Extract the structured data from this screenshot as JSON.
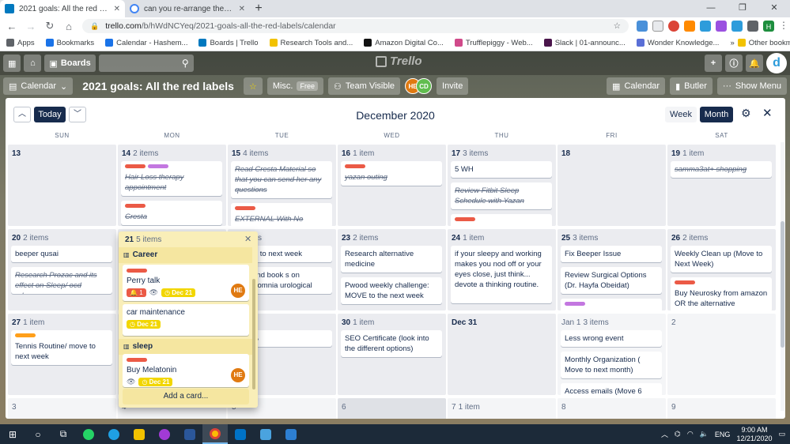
{
  "browser": {
    "tabs": [
      {
        "title": "2021 goals: All the red labels | Tr",
        "active": true
      },
      {
        "title": "can you re-arrange the cards in a",
        "active": false
      }
    ],
    "url_host": "trello.com",
    "url_path": "/b/hWdNCYeq/2021-goals-all-the-red-labels/calendar",
    "bookmarks": [
      {
        "label": "Apps",
        "color": "#5f6368"
      },
      {
        "label": "Bookmarks",
        "color": "#1a73e8"
      },
      {
        "label": "Calendar - Hashem...",
        "color": "#1a73e8"
      },
      {
        "label": "Boards | Trello",
        "color": "#0079bf"
      },
      {
        "label": "Research Tools and...",
        "color": "#f2c200"
      },
      {
        "label": "Amazon Digital Co...",
        "color": "#111111"
      },
      {
        "label": "Trufflepiggy - Web...",
        "color": "#d04a8a"
      },
      {
        "label": "Slack | 01-announc...",
        "color": "#4a154b"
      },
      {
        "label": "Wonder Knowledge...",
        "color": "#5a6fd6"
      }
    ],
    "other_bookmarks": "Other bookmarks",
    "profile_initial": "H"
  },
  "trello": {
    "boards_label": "Boards",
    "logo_text": "Trello",
    "board_view": "Calendar",
    "board_title": "2021 goals: All the red labels",
    "team_name": "Misc.",
    "team_plan": "Free",
    "visibility": "Team Visible",
    "members": [
      "HE",
      "CD"
    ],
    "invite": "Invite",
    "calendar_btn": "Calendar",
    "butler_btn": "Butler",
    "menu_btn": "Show Menu"
  },
  "calendar": {
    "today_label": "Today",
    "month_title": "December 2020",
    "week_label": "Week",
    "month_label": "Month",
    "days_of_week": [
      "SUN",
      "MON",
      "TUE",
      "WED",
      "THU",
      "FRI",
      "SAT"
    ],
    "weeks": [
      [
        {
          "day": "13",
          "count": "",
          "cards": []
        },
        {
          "day": "14",
          "count": "2 items",
          "cards": [
            {
              "labels": [
                "red",
                "purple"
              ],
              "text": "Hair Loss therapy appointment",
              "done": true
            },
            {
              "labels": [
                "red"
              ],
              "text": "Cresta",
              "done": true
            }
          ]
        },
        {
          "day": "15",
          "count": "4 items",
          "cards": [
            {
              "labels": [],
              "text": "Read Cresta Material so that you can send her any questions",
              "done": true
            },
            {
              "labels": [
                "red"
              ],
              "text": "EXTERNAL With No",
              "done": true
            }
          ]
        },
        {
          "day": "16",
          "count": "1 item",
          "cards": [
            {
              "labels": [
                "red"
              ],
              "text": "yazan outing",
              "done": true
            }
          ]
        },
        {
          "day": "17",
          "count": "3 items",
          "cards": [
            {
              "labels": [],
              "text": "5 WH",
              "done": false
            },
            {
              "labels": [],
              "text": "Review Fitbit Sleep Schedule with Yazan",
              "done": true
            },
            {
              "labels": [
                "red"
              ],
              "text": "",
              "done": false
            }
          ]
        },
        {
          "day": "18",
          "count": "",
          "cards": []
        },
        {
          "day": "19",
          "count": "1 item",
          "cards": [
            {
              "labels": [],
              "text": "samma3at+ shopping",
              "done": true
            }
          ]
        }
      ],
      [
        {
          "day": "20",
          "count": "2 items",
          "cards": [
            {
              "labels": [],
              "text": "beeper qusai",
              "done": false
            },
            {
              "labels": [],
              "text": "Research Prozac and its effect on Sleep/ ocd advance",
              "done": true
            }
          ]
        },
        {
          "day": "21",
          "count": "5 items",
          "cards": []
        },
        {
          "day": "22",
          "count": "items",
          "cards": [
            {
              "labels": [],
              "text": "ng: put to next week",
              "done": false
            },
            {
              "labels": [],
              "text": "t RG and book s on hypersomnia urological issues",
              "done": false
            }
          ]
        },
        {
          "day": "23",
          "count": "2 items",
          "cards": [
            {
              "labels": [],
              "text": "Research alternative medicine",
              "done": false
            },
            {
              "labels": [],
              "text": "Pwood weekly challenge: MOVE to the next week",
              "done": false
            }
          ]
        },
        {
          "day": "24",
          "count": "1 item",
          "cards": [
            {
              "labels": [],
              "text": "if your sleepy and working makes you nod off or your eyes close, just think... devote a thinking routine.",
              "done": false
            }
          ]
        },
        {
          "day": "25",
          "count": "3 items",
          "cards": [
            {
              "labels": [],
              "text": "Fix Beeper Issue",
              "done": false
            },
            {
              "labels": [],
              "text": "Review Surgical Options (Dr. Hayfa Obeidat)",
              "done": false
            },
            {
              "labels": [
                "purple"
              ],
              "text": "",
              "done": false
            }
          ]
        },
        {
          "day": "26",
          "count": "2 items",
          "cards": [
            {
              "labels": [],
              "text": "Weekly Clean up (Move to Next Week)",
              "done": false
            },
            {
              "labels": [
                "red"
              ],
              "text": "Buy Neurosky from amazon OR the alternative",
              "done": false
            }
          ]
        }
      ],
      [
        {
          "day": "27",
          "count": "1 item",
          "cards": [
            {
              "labels": [
                "orange"
              ],
              "text": "Tennis Routine/ move to next week",
              "done": false
            }
          ]
        },
        {
          "day": "28",
          "count": "",
          "cards": []
        },
        {
          "day": "29",
          "count": "item",
          "cards": [
            {
              "labels": [],
              "text": "محالصة",
              "done": false
            }
          ]
        },
        {
          "day": "30",
          "count": "1 item",
          "cards": [
            {
              "labels": [],
              "text": "SEO Certificate (look into the different options)",
              "done": false
            }
          ]
        },
        {
          "day": "Dec 31",
          "count": "",
          "cards": []
        },
        {
          "day": "Jan 1",
          "count": "3 items",
          "cards": [
            {
              "labels": [],
              "text": "Less wrong event",
              "done": false
            },
            {
              "labels": [],
              "text": "Monthly Organization ( Move to next month)",
              "done": false
            },
            {
              "labels": [],
              "text": "Access emails (Move 6",
              "done": false
            }
          ]
        },
        {
          "day": "2",
          "count": "",
          "cards": []
        }
      ],
      [
        {
          "day": "3",
          "count": ""
        },
        {
          "day": "4",
          "count": ""
        },
        {
          "day": "5",
          "count": ""
        },
        {
          "day": "6",
          "count": ""
        },
        {
          "day": "7",
          "count": "1 item"
        },
        {
          "day": "8",
          "count": ""
        },
        {
          "day": "9",
          "count": ""
        }
      ]
    ],
    "popover": {
      "day": "21",
      "count": "5 items",
      "group1": "Career",
      "group2": "sleep",
      "card1": {
        "text": "Perry talk",
        "overdue": "1",
        "due": "Dec 21",
        "member": "HE"
      },
      "card2": {
        "text": "car maintenance",
        "due": "Dec 21"
      },
      "card3": {
        "text": "Buy Melatonin",
        "due": "Dec 21",
        "member": "HE"
      },
      "add_card": "Add a card..."
    }
  },
  "taskbar": {
    "language": "ENG",
    "time": "9:00 AM",
    "date": "12/21/2020"
  }
}
